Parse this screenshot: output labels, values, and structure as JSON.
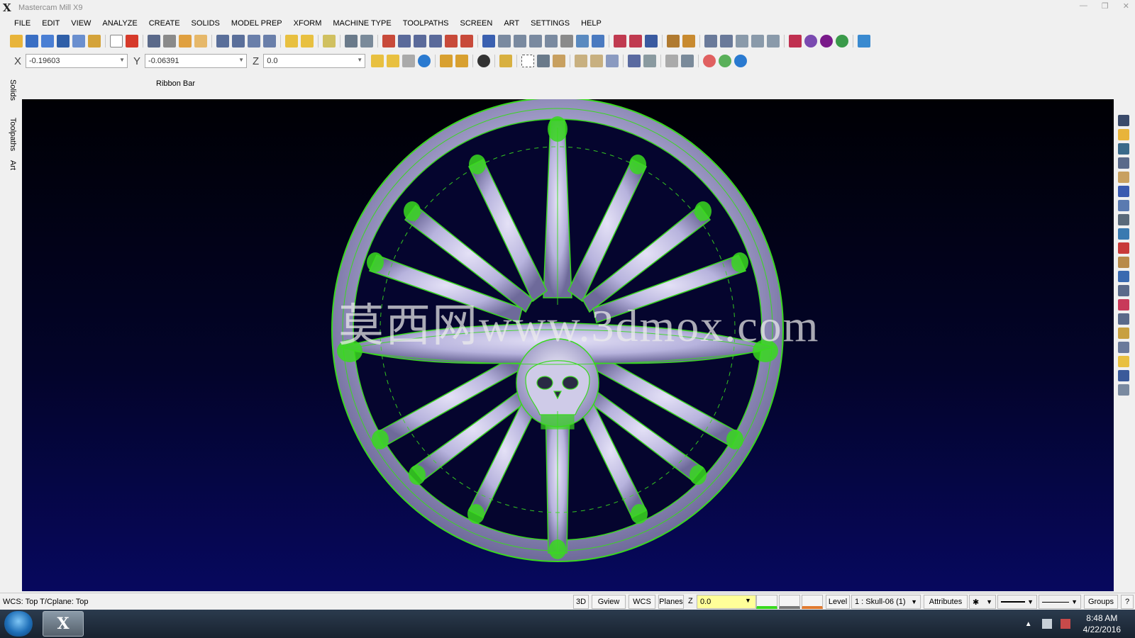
{
  "app": {
    "title": "Mastercam Mill X9"
  },
  "menu": [
    "FILE",
    "EDIT",
    "VIEW",
    "ANALYZE",
    "CREATE",
    "SOLIDS",
    "MODEL PREP",
    "XFORM",
    "MACHINE TYPE",
    "TOOLPATHS",
    "SCREEN",
    "ART",
    "SETTINGS",
    "HELP"
  ],
  "coords": {
    "x_label": "X",
    "x_value": "-0.19603",
    "y_label": "Y",
    "y_value": "-0.06391",
    "z_label": "Z",
    "z_value": "0.0"
  },
  "ribbon": {
    "label": "Ribbon Bar"
  },
  "side_tabs": {
    "solids": "Solids",
    "toolpaths": "Toolpaths",
    "art": "Art"
  },
  "viewport": {
    "watermark": "莫西网www.3dmox.com"
  },
  "status": {
    "wcs": "WCS: Top  T/Cplane: Top",
    "btn_3d": "3D",
    "gview": "Gview",
    "wcs_btn": "WCS",
    "planes": "Planes",
    "z_label": "Z",
    "z_value": "0.0",
    "level_label": "Level",
    "level_value": "1 : Skull-06 (1)",
    "attributes": "Attributes",
    "groups": "Groups",
    "help": "?"
  },
  "taskbar": {
    "time": "8:48 AM",
    "date": "4/22/2016"
  },
  "colors": {
    "wireframe": "#39d91f",
    "model": "#b7b3dd",
    "viewport_top": "#000004",
    "viewport_bottom": "#07085e",
    "z_field": "#ffff99"
  },
  "icons": [
    "app-x-icon",
    "open-icon",
    "save-icon",
    "new-icon",
    "delete-icon",
    "analyze-icon",
    "line-icon",
    "point-icon",
    "arc-icon",
    "solid-icon",
    "toolpath-icon",
    "help-icon",
    "fit-icon",
    "start-orb-icon"
  ]
}
